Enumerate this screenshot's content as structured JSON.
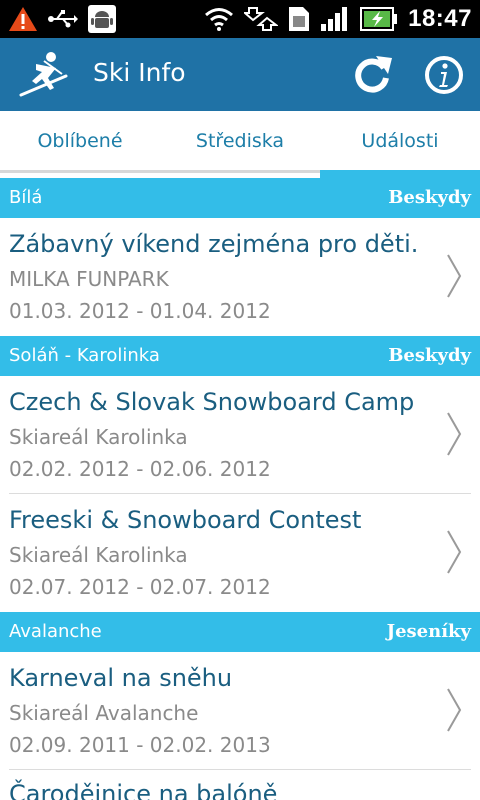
{
  "status": {
    "time": "18:47"
  },
  "app": {
    "title": "Ski Info"
  },
  "tabs": [
    {
      "label": "Oblíbené",
      "active": false
    },
    {
      "label": "Střediska",
      "active": false
    },
    {
      "label": "Události",
      "active": true
    }
  ],
  "sections": [
    {
      "resort": "Bílá",
      "region": "Beskydy",
      "events": [
        {
          "title": "Zábavný víkend zejména pro děti.",
          "place": "MILKA FUNPARK",
          "dates": "01.03. 2012 - 01.04. 2012"
        }
      ]
    },
    {
      "resort": "Soláň - Karolinka",
      "region": "Beskydy",
      "events": [
        {
          "title": "Czech & Slovak Snowboard Camp",
          "place": "Skiareál Karolinka",
          "dates": "02.02. 2012 - 02.06. 2012"
        },
        {
          "title": "Freeski & Snowboard Contest",
          "place": "Skiareál Karolinka",
          "dates": "02.07. 2012 - 02.07. 2012"
        }
      ]
    },
    {
      "resort": "Avalanche",
      "region": "Jeseníky",
      "events": [
        {
          "title": "Karneval na sněhu",
          "place": "Skiareál Avalanche",
          "dates": "02.09. 2011 - 02.02. 2013"
        },
        {
          "title": "Čarodějnice na balóně",
          "place": "",
          "dates": ""
        }
      ]
    }
  ],
  "colors": {
    "appbar": "#1f72a6",
    "accent": "#33bde8",
    "title_text": "#1a5e80",
    "tab_text": "#1d7ea8"
  },
  "icons": [
    "warning-icon",
    "usb-icon",
    "android-debug-icon",
    "wifi-icon",
    "data-transfer-icon",
    "sim-icon",
    "signal-icon",
    "battery-charging-icon",
    "skier-logo-icon",
    "refresh-icon",
    "info-icon",
    "chevron-right-icon"
  ]
}
